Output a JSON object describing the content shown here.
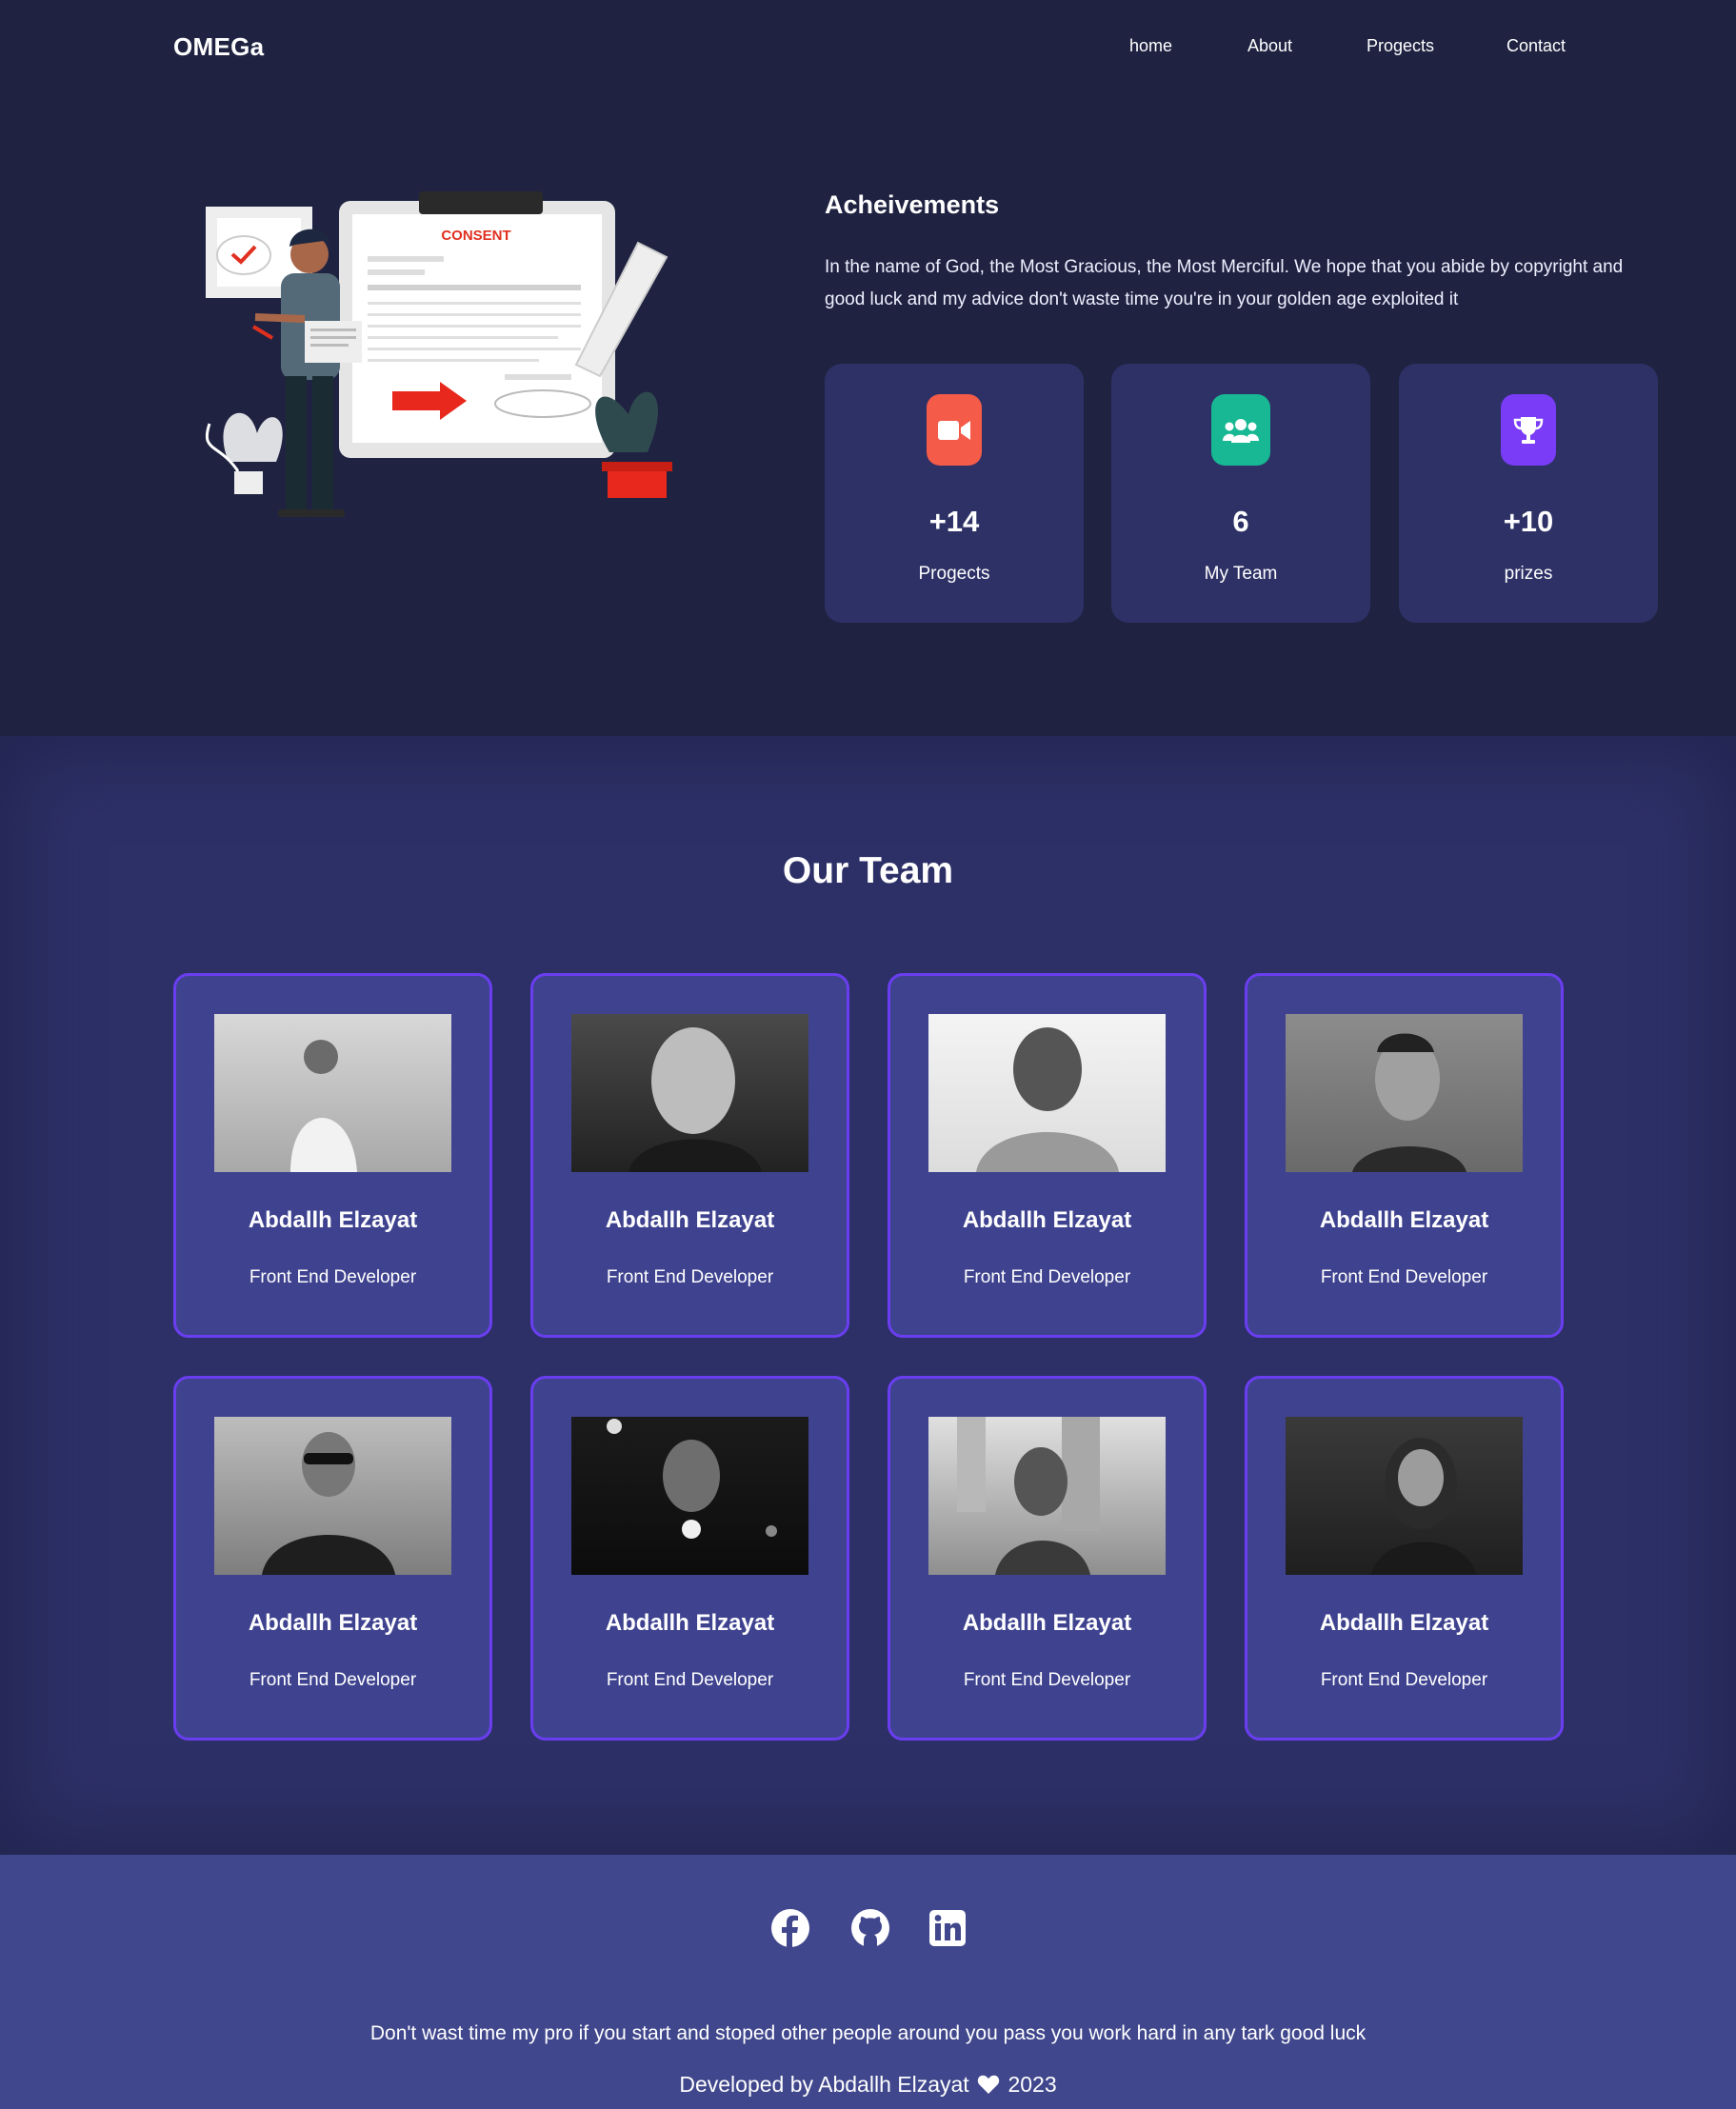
{
  "header": {
    "logo": "OMEGa",
    "nav": [
      "home",
      "About",
      "Progects",
      "Contact"
    ]
  },
  "hero": {
    "illustration_label": "CONSENT",
    "title": "Acheivements",
    "text": "In the name of God, the Most Gracious, the Most Merciful. We hope that you abide by copyright and good luck and my advice don't waste time you're in your golden age exploited it",
    "stats": [
      {
        "icon": "video-camera-icon",
        "color": "#f45b49",
        "value": "+14",
        "label": "Progects"
      },
      {
        "icon": "team-users-icon",
        "color": "#17b893",
        "value": "6",
        "label": "My Team"
      },
      {
        "icon": "trophy-icon",
        "color": "#7a3cf7",
        "value": "+10",
        "label": "prizes"
      }
    ]
  },
  "team": {
    "title": "Our Team",
    "members": [
      {
        "name": "Abdallh Elzayat",
        "role": "Front End Developer"
      },
      {
        "name": "Abdallh Elzayat",
        "role": "Front End Developer"
      },
      {
        "name": "Abdallh Elzayat",
        "role": "Front End Developer"
      },
      {
        "name": "Abdallh Elzayat",
        "role": "Front End Developer"
      },
      {
        "name": "Abdallh Elzayat",
        "role": "Front End Developer"
      },
      {
        "name": "Abdallh Elzayat",
        "role": "Front End Developer"
      },
      {
        "name": "Abdallh Elzayat",
        "role": "Front End Developer"
      },
      {
        "name": "Abdallh Elzayat",
        "role": "Front End Developer"
      }
    ]
  },
  "footer": {
    "socials": [
      "facebook-icon",
      "github-icon",
      "linkedin-icon"
    ],
    "text": "Don't wast time my pro if you start and stoped other people around you pass you work hard in any tark good luck",
    "credit_prefix": "Developed by Abdallh Elzayat",
    "credit_year": "2023"
  },
  "colors": {
    "page_bg": "#1f2341",
    "card_bg": "#2e3166",
    "team_bg": "#2d3067",
    "member_bg": "#3f438f",
    "member_border": "#6a3ef0",
    "footer_bg": "#40478c"
  }
}
